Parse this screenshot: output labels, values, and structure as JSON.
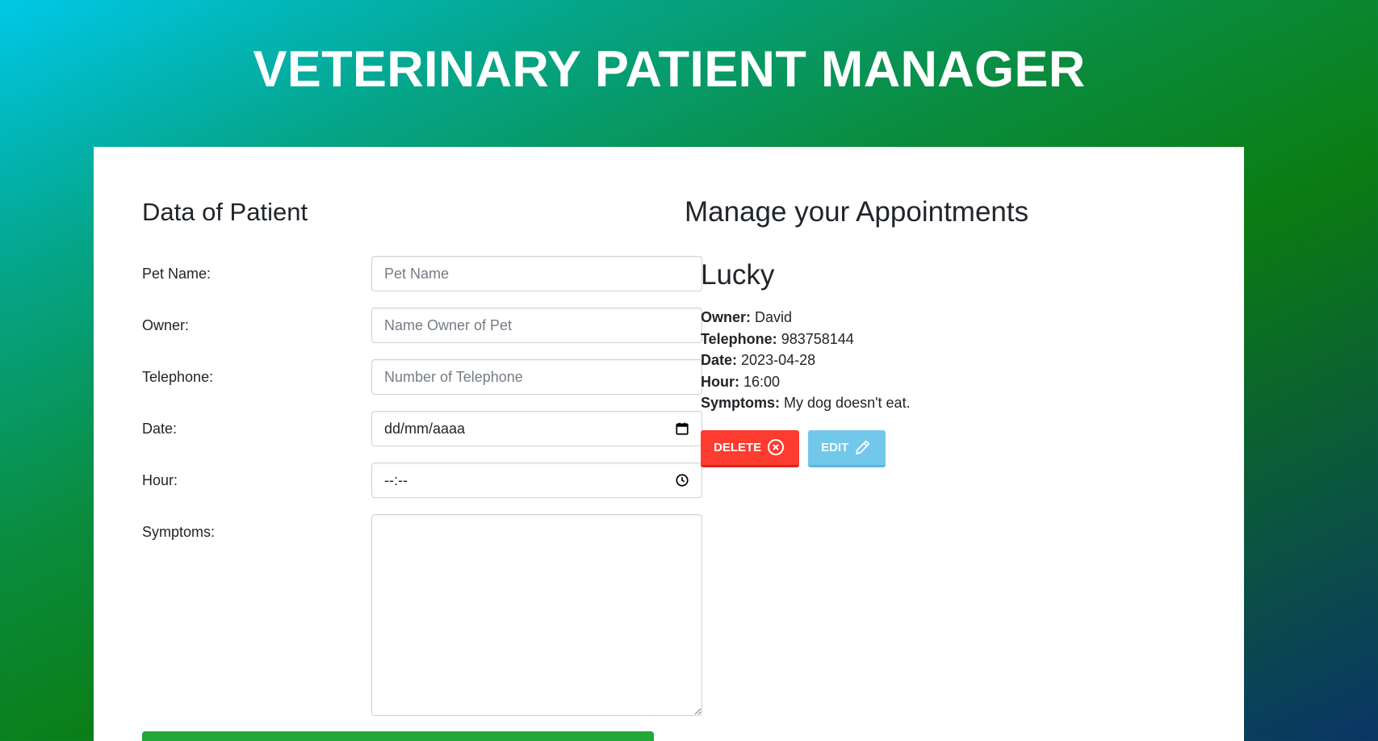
{
  "app": {
    "title": "VETERINARY PATIENT MANAGER"
  },
  "form": {
    "heading": "Data of Patient",
    "fields": [
      {
        "label": "Pet Name:",
        "placeholder": "Pet Name",
        "value": ""
      },
      {
        "label": "Owner:",
        "placeholder": "Name Owner of Pet",
        "value": ""
      },
      {
        "label": "Telephone:",
        "placeholder": "Number of Telephone",
        "value": ""
      },
      {
        "label": "Date:",
        "placeholder": "",
        "value": "dd/mm/aaaa",
        "icon": "calendar-icon"
      },
      {
        "label": "Hour:",
        "placeholder": "",
        "value": "--:--",
        "icon": "clock-icon"
      },
      {
        "label": "Symptoms:",
        "placeholder": "",
        "value": ""
      }
    ]
  },
  "appointments": {
    "heading": "Manage your Appointments",
    "items": [
      {
        "pet_name": "Lucky",
        "owner_label": "Owner:",
        "owner": "David",
        "telephone_label": "Telephone:",
        "telephone": "983758144",
        "date_label": "Date:",
        "date": "2023-04-28",
        "hour_label": "Hour:",
        "hour": "16:00",
        "symptoms_label": "Symptoms:",
        "symptoms": "My dog doesn't eat.",
        "delete_label": "DELETE",
        "delete_icon": "close-circle-icon",
        "edit_label": "EDIT",
        "edit_icon": "pencil-icon"
      }
    ]
  },
  "colors": {
    "delete": "#fd3b2f",
    "edit": "#72c8ea",
    "submit": "#23a736",
    "title_text": "#ffffff"
  }
}
